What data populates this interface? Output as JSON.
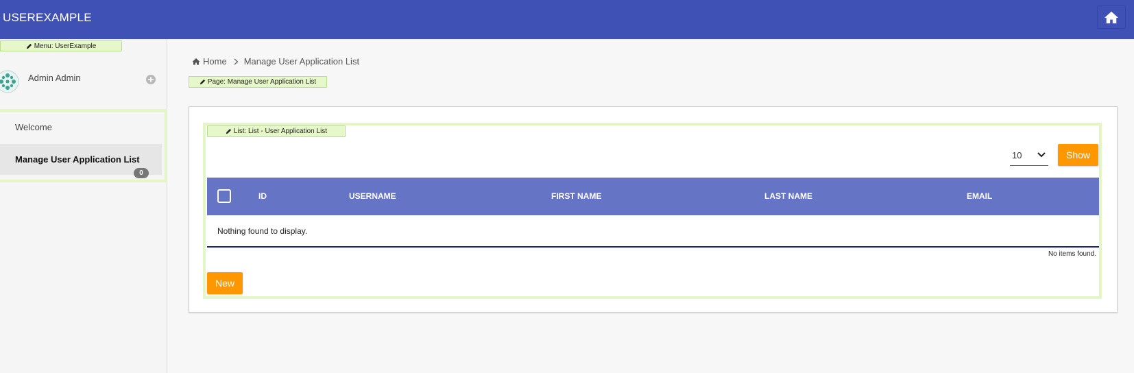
{
  "header": {
    "app_title": "USEREXAMPLE",
    "home_icon": "home-icon"
  },
  "sidebar": {
    "menu_tag": "Menu: UserExample",
    "user_name": "Admin Admin",
    "items": [
      {
        "label": "Welcome",
        "active": false
      },
      {
        "label": "Manage User Application List",
        "active": true,
        "count": "0"
      }
    ]
  },
  "breadcrumb": {
    "home": "Home",
    "current": "Manage User Application List"
  },
  "page_tag": "Page: Manage User Application List",
  "list": {
    "list_tag": "List: List - User Application List",
    "page_size": "10",
    "show_label": "Show",
    "columns": [
      "ID",
      "USERNAME",
      "FIRST NAME",
      "LAST NAME",
      "EMAIL"
    ],
    "empty_message": "Nothing found to display.",
    "no_items": "No items found.",
    "new_label": "New"
  },
  "colors": {
    "header": "#3f51b5",
    "table_header": "#6674c6",
    "accent": "#ff9800",
    "edit_tag": "#e6f7c9"
  }
}
